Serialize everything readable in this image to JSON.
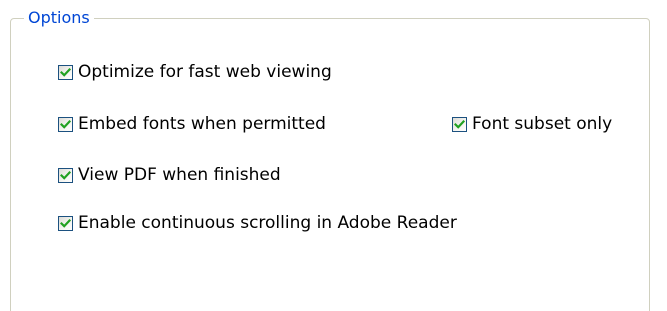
{
  "group": {
    "title": "Options"
  },
  "options": [
    {
      "label": "Optimize for fast web viewing",
      "checked": true
    },
    {
      "label": "Embed fonts when permitted",
      "checked": true
    },
    {
      "label": "Font subset only",
      "checked": true
    },
    {
      "label": "View PDF when finished",
      "checked": true
    },
    {
      "label": "Enable continuous scrolling in Adobe Reader",
      "checked": true
    }
  ],
  "colors": {
    "title": "#0046d5",
    "checkbox_border": "#1c5180",
    "checkmark": "#21a121",
    "frame": "#d0d0bf"
  }
}
